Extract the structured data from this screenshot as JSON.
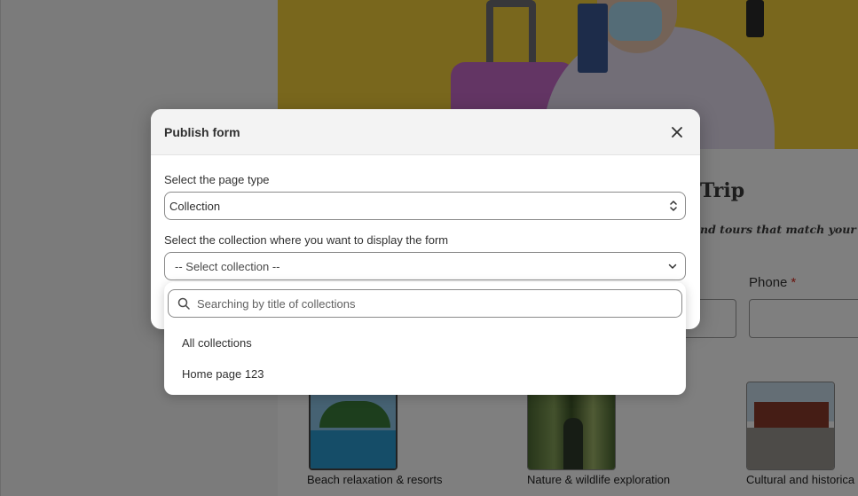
{
  "preview": {
    "heading_partial": "Trip",
    "subheading_partial": "nd tours that match your style.",
    "phone_label": "Phone",
    "required_mark": "*",
    "cards": [
      {
        "label": "Beach relaxation & resorts"
      },
      {
        "label": "Nature & wildlife exploration"
      },
      {
        "label": "Cultural and historica"
      }
    ]
  },
  "modal": {
    "title": "Publish form",
    "page_type_label": "Select the page type",
    "page_type_value": "Collection",
    "collection_label": "Select the collection where you want to display the form",
    "collection_value": "-- Select collection --"
  },
  "dropdown": {
    "search_placeholder": "Searching by title of collections",
    "options": [
      {
        "label": "All collections"
      },
      {
        "label": "Home page 123"
      }
    ]
  },
  "icons": {
    "close": "close-icon",
    "search": "search-icon",
    "chevron": "chevron-down-icon",
    "stepper": "select-stepper-icon"
  },
  "colors": {
    "hero_bg": "#f2cf3b",
    "required": "#d4281d",
    "overlay": "rgba(0,0,0,0.5)"
  }
}
